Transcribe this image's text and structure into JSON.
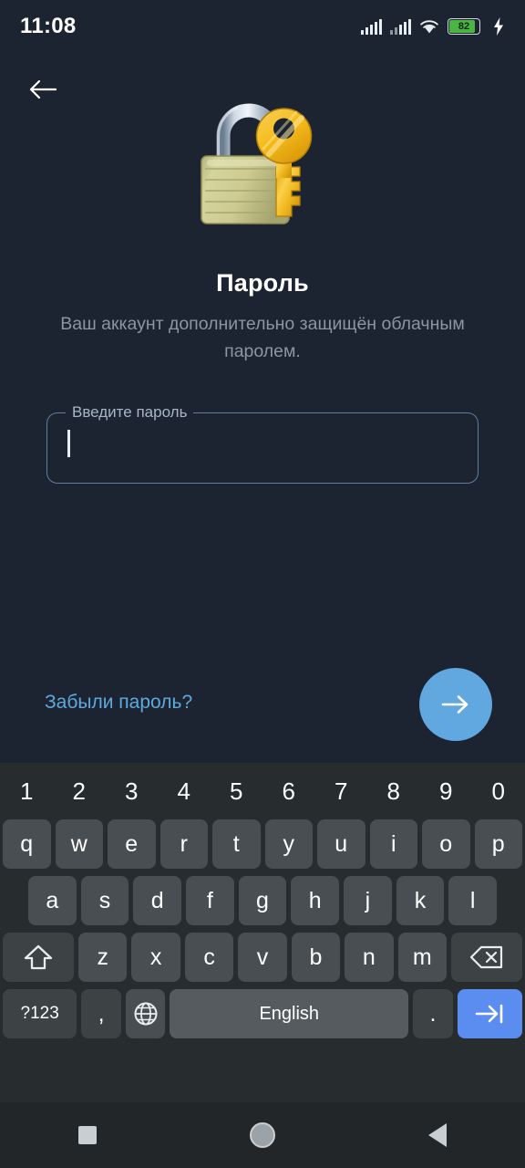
{
  "status_bar": {
    "time": "11:08",
    "battery_percent": "82",
    "icons": [
      "signal-icon",
      "signal-icon",
      "wifi-icon",
      "battery-icon",
      "charging-bolt-icon"
    ]
  },
  "screen": {
    "back_icon": "back-arrow-icon",
    "illustration": "lock-and-key-icon",
    "title": "Пароль",
    "subtitle": "Ваш аккаунт дополнительно защищён облачным паролем.",
    "password_field": {
      "label": "Введите пароль",
      "value": "",
      "placeholder": ""
    },
    "forgot_link": "Забыли пароль?",
    "submit_icon": "arrow-right-icon"
  },
  "colors": {
    "background": "#1c2431",
    "accent": "#62a8e0",
    "link": "#5ea9de",
    "field_border": "#5f7d9e",
    "subtitle_text": "#8a96a3",
    "keyboard_bg": "#272c2f",
    "key_bg": "#494e52",
    "key_fn_bg": "#3d4245",
    "key_action_bg": "#5b8cf0",
    "battery_fill": "#4bb543"
  },
  "keyboard": {
    "language": "English",
    "rows": [
      {
        "type": "numbers",
        "keys": [
          "1",
          "2",
          "3",
          "4",
          "5",
          "6",
          "7",
          "8",
          "9",
          "0"
        ]
      },
      {
        "type": "letters",
        "keys": [
          "q",
          "w",
          "e",
          "r",
          "t",
          "y",
          "u",
          "i",
          "o",
          "p"
        ]
      },
      {
        "type": "letters",
        "keys": [
          "a",
          "s",
          "d",
          "f",
          "g",
          "h",
          "j",
          "k",
          "l"
        ]
      },
      {
        "type": "letters",
        "keys": [
          "z",
          "x",
          "c",
          "v",
          "b",
          "n",
          "m"
        ]
      }
    ],
    "shift_key": "shift-icon",
    "backspace_key": "backspace-icon",
    "symbols_key": "?123",
    "comma_key": ",",
    "globe_key": "globe-icon",
    "space_key": "English",
    "period_key": ".",
    "action_key": "tab-next-icon"
  },
  "nav_bar": {
    "recents": "square-icon",
    "home": "circle-icon",
    "back": "triangle-back-icon"
  }
}
